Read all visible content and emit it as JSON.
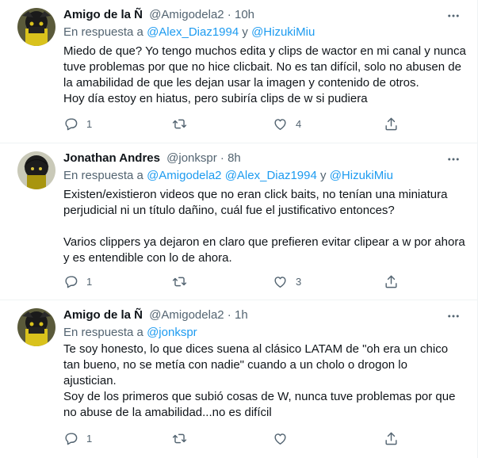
{
  "tweets": [
    {
      "name": "Amigo de la Ñ",
      "handle": "@Amigodela2",
      "dot": " · ",
      "time": "10h",
      "reply_prefix": "En respuesta a ",
      "mentions": [
        "@Alex_Diaz1994",
        "@HizukiMiu"
      ],
      "joiners": [
        " y "
      ],
      "lines": [
        "Miedo de que? Yo tengo muchos edita y clips de wactor en mi canal y nunca",
        "tuve problemas por que no hice clicbait. No es tan difícil, solo no abusen de",
        "la amabilidad de que les dejan usar la imagen y contenido de otros.",
        "Hoy día estoy en hiatus, pero subiría clips de w si pudiera"
      ],
      "reply_count": "1",
      "retweet_count": "",
      "like_count": "4"
    },
    {
      "name": "Jonathan Andres",
      "handle": "@jonkspr",
      "dot": " · ",
      "time": "8h",
      "reply_prefix": "En respuesta a ",
      "mentions": [
        "@Amigodela2",
        "@Alex_Diaz1994",
        "@HizukiMiu"
      ],
      "joiners": [
        " ",
        " y "
      ],
      "lines": [
        "Existen/existieron videos que no eran click baits, no tenían una miniatura",
        "perjudicial ni un título dañino, cuál fue el justificativo entonces?",
        "",
        "Varios clippers ya dejaron en claro que prefieren evitar clipear a w por ahora",
        "y es entendible con lo de ahora."
      ],
      "reply_count": "1",
      "retweet_count": "",
      "like_count": "3"
    },
    {
      "name": "Amigo de la Ñ",
      "handle": "@Amigodela2",
      "dot": " · ",
      "time": "1h",
      "reply_prefix": "En respuesta a ",
      "mentions": [
        "@jonkspr"
      ],
      "joiners": [],
      "lines": [
        "Te soy honesto, lo que dices suena al clásico LATAM de \"oh era un chico",
        "tan bueno, no se metía con nadie\" cuando a un cholo o drogon lo",
        "ajustician.",
        "Soy de los primeros que subió cosas de W, nunca tuve problemas por que",
        "no abuse de la amabilidad...no es difícil"
      ],
      "reply_count": "1",
      "retweet_count": "",
      "like_count": ""
    }
  ],
  "icons": {
    "avatar": "avatar-image",
    "more": "more-icon",
    "reply": "reply-icon",
    "retweet": "retweet-icon",
    "like": "like-icon",
    "share": "share-icon"
  },
  "colors": {
    "text": "#0f1419",
    "secondary": "#536471",
    "link": "#1d9bf0",
    "border": "#eff3f4",
    "avatar_hair": "#1a1a1a",
    "avatar_yellow": "#d9c21c"
  }
}
